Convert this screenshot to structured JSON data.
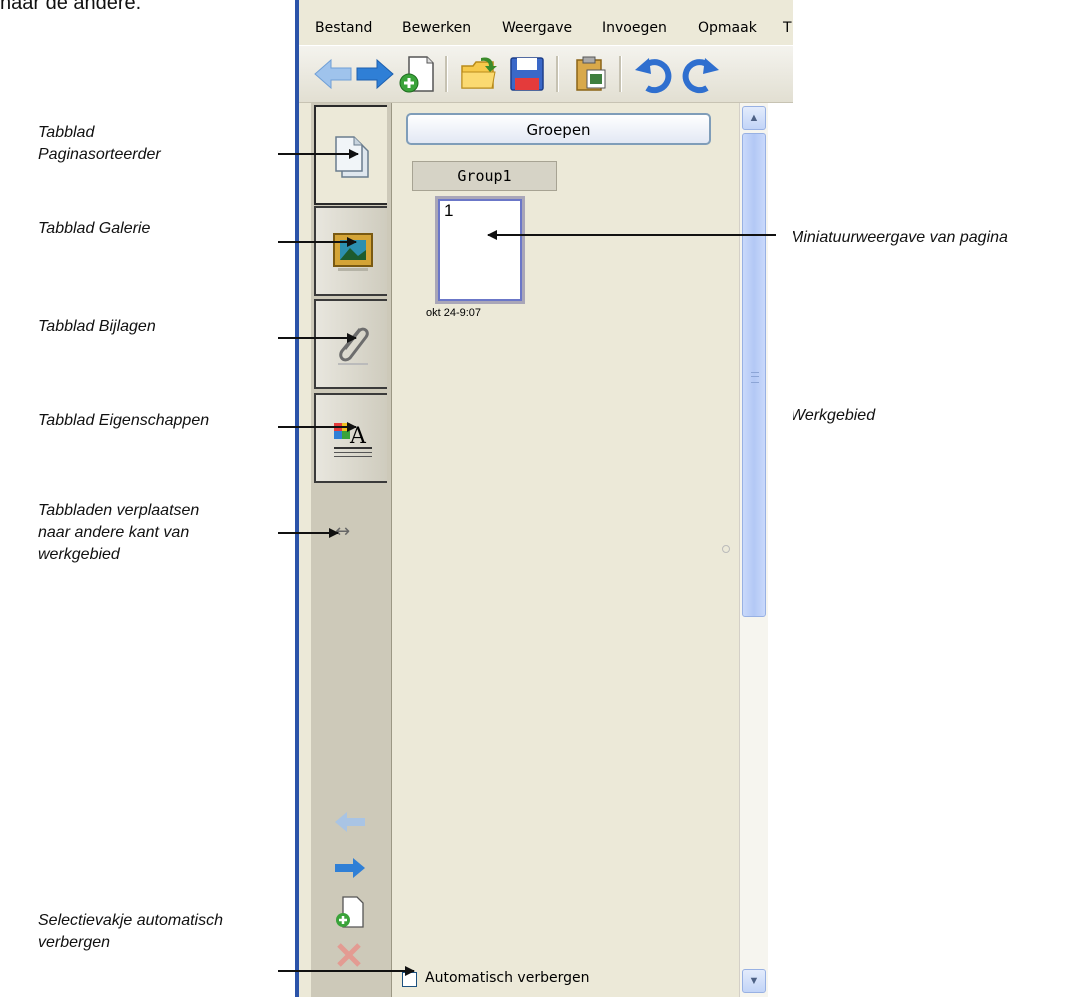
{
  "top_fragment": "naar de andere.",
  "menu": [
    "Bestand",
    "Bewerken",
    "Weergave",
    "Invoegen",
    "Opmaak",
    "T"
  ],
  "toolbar_icons": [
    "back-arrow-icon",
    "forward-arrow-icon",
    "new-page-icon",
    "open-folder-icon",
    "save-disk-icon",
    "paste-clipboard-icon",
    "undo-icon",
    "redo-icon"
  ],
  "panel": {
    "groups_button": "Groepen",
    "group_name": "Group1",
    "thumbnail": {
      "number": "1",
      "date": "okt 24-9:07"
    },
    "autohide_label": "Automatisch verbergen",
    "autohide_checked": false
  },
  "callouts": {
    "paginasorteerder": [
      "Tabblad",
      "Paginasorteerder"
    ],
    "galerie": "Tabblad Galerie",
    "bijlagen": "Tabblad Bijlagen",
    "eigenschappen": "Tabblad Eigenschappen",
    "verplaatsen": [
      "Tabbladen verplaatsen",
      "naar andere kant van",
      "werkgebied"
    ],
    "autohide": [
      "Selectievakje automatisch",
      "verbergen"
    ],
    "miniatuur": "Miniatuurweergave van pagina",
    "werkgebied": "Werkgebied"
  },
  "colors": {
    "frame_blue": "#2b53a8",
    "panel_bg": "#ece9d8",
    "tabstrip_bg": "#cdc9b9",
    "arrow_blue": "#2f7fd6"
  }
}
